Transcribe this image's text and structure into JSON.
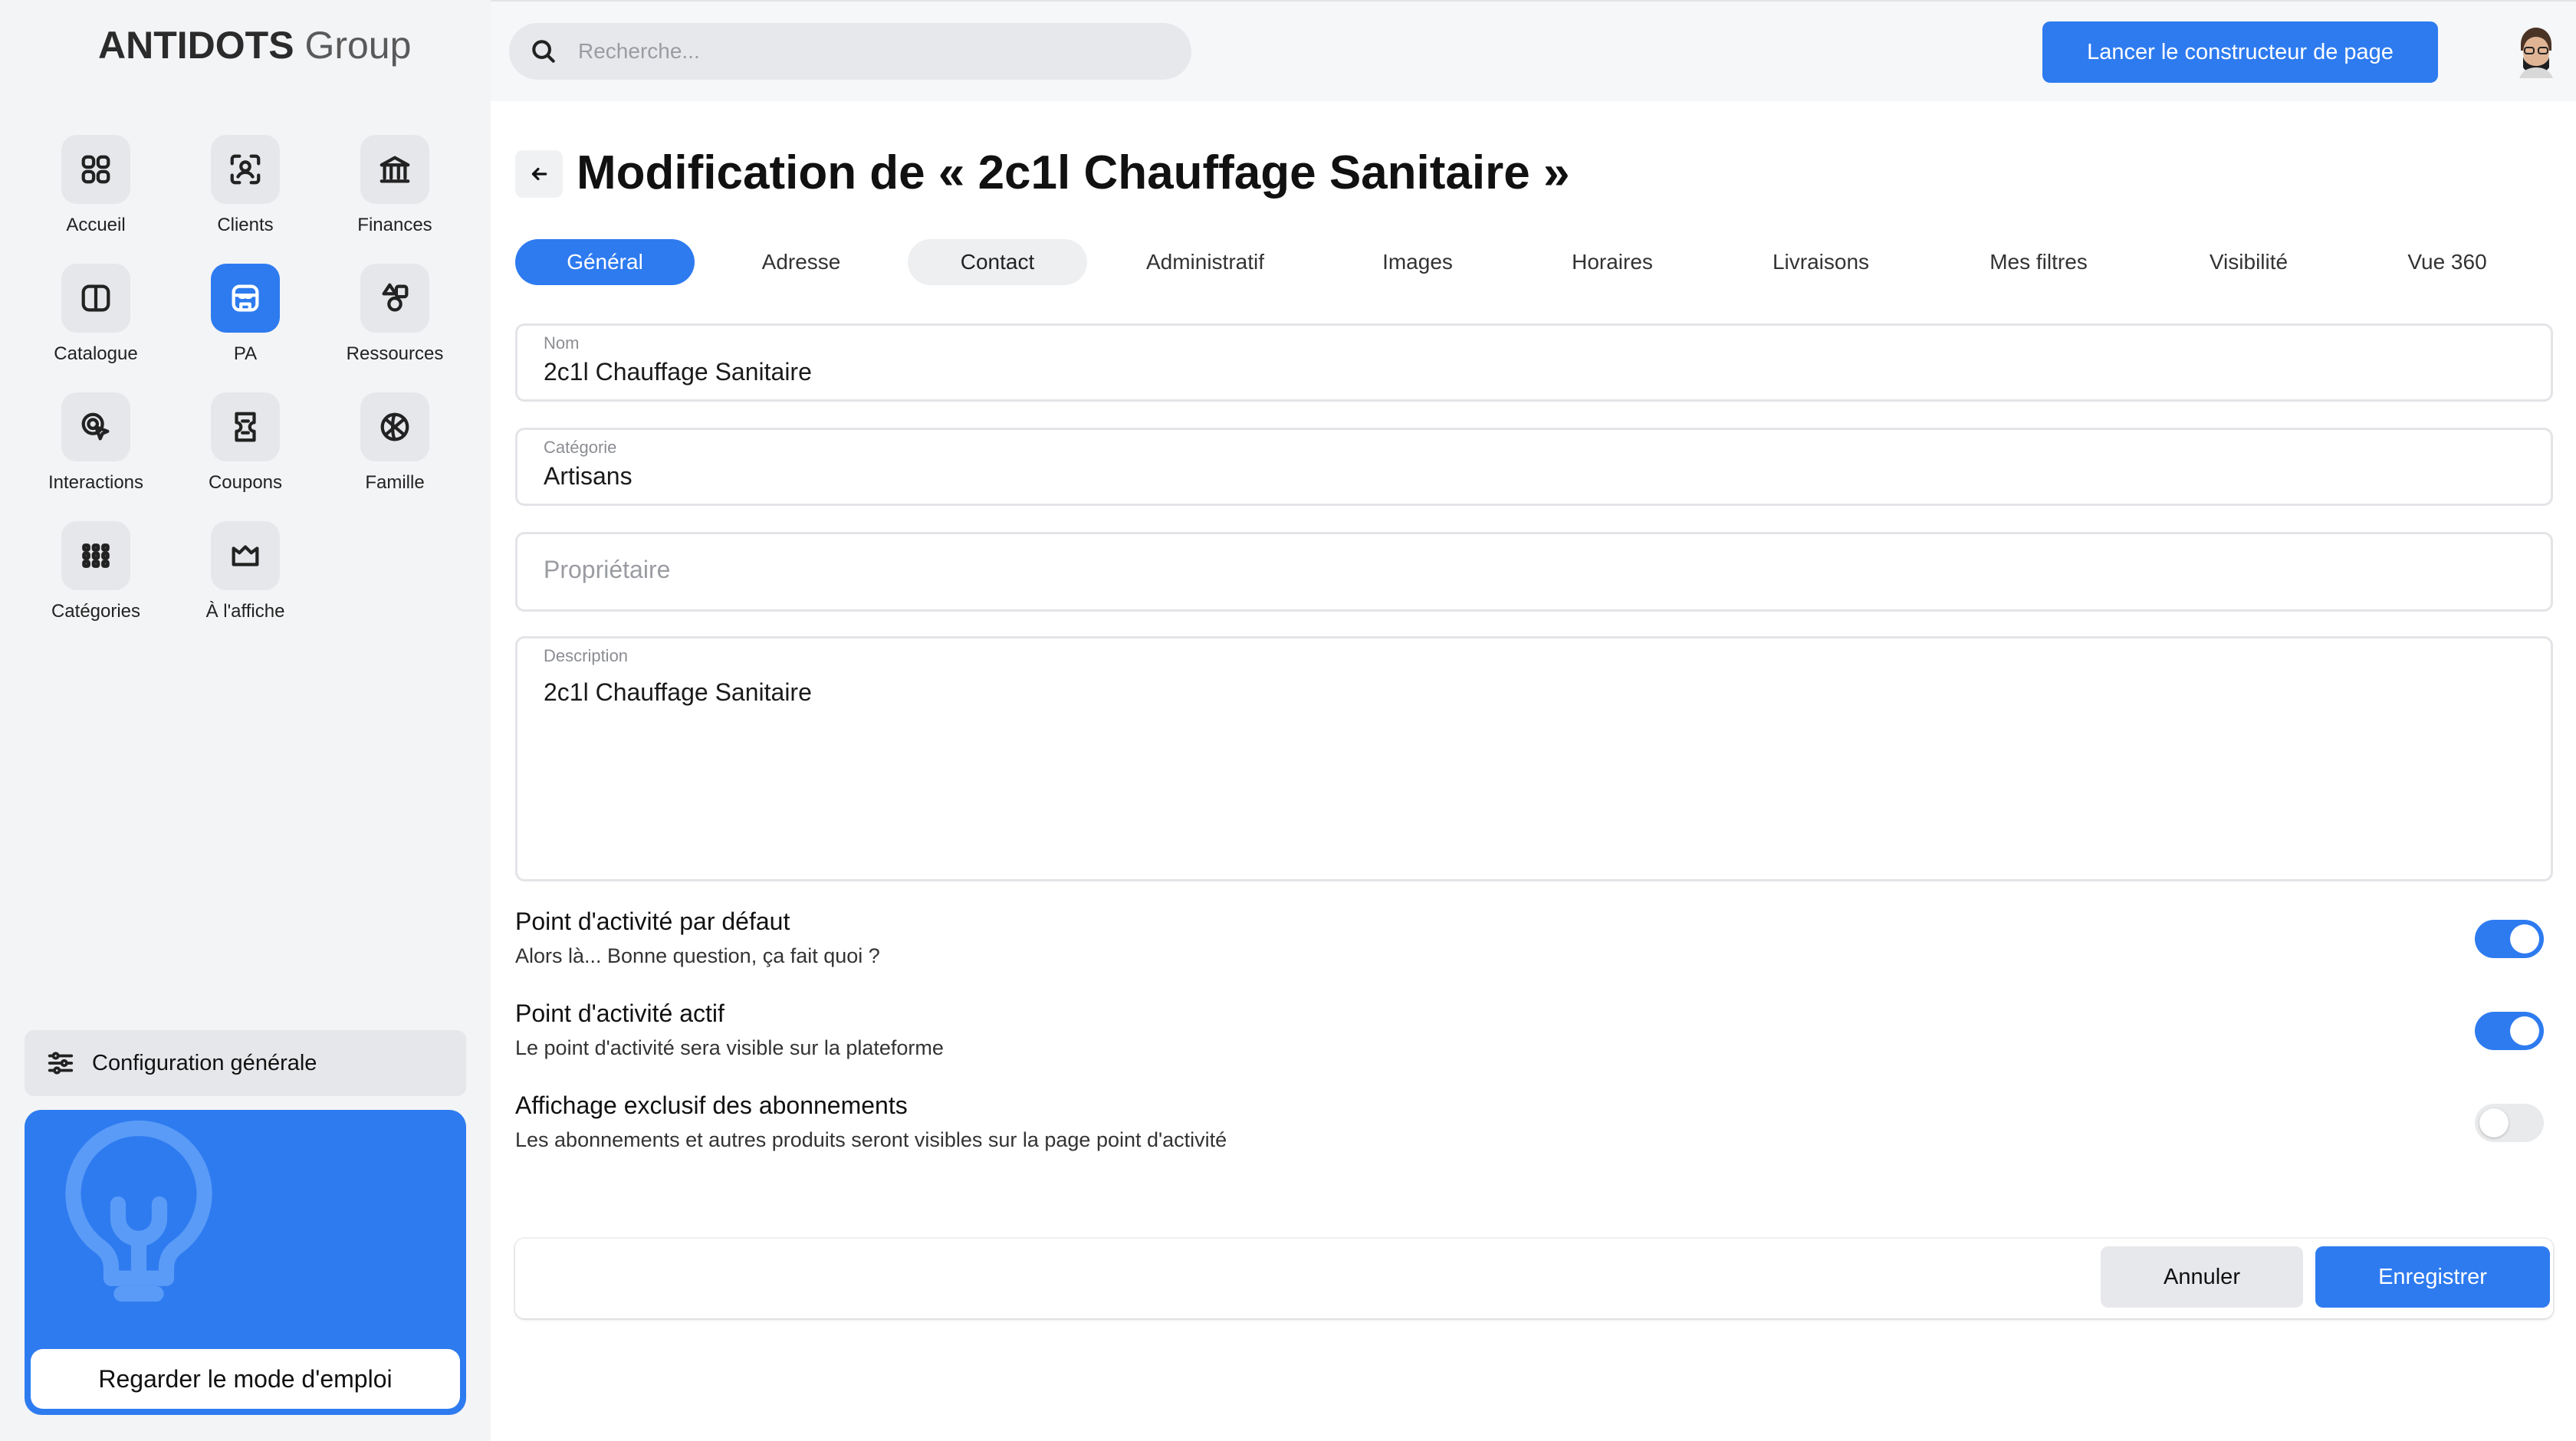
{
  "brand": {
    "name_bold": "ANTIDOTS",
    "name_light": " Group"
  },
  "sidebar": {
    "items": [
      {
        "label": "Accueil",
        "icon": "grid-icon"
      },
      {
        "label": "Clients",
        "icon": "user-scan-icon"
      },
      {
        "label": "Finances",
        "icon": "bank-icon"
      },
      {
        "label": "Catalogue",
        "icon": "book-icon"
      },
      {
        "label": "PA",
        "icon": "store-icon",
        "active": true
      },
      {
        "label": "Ressources",
        "icon": "shapes-icon"
      },
      {
        "label": "Interactions",
        "icon": "cursor-click-icon"
      },
      {
        "label": "Coupons",
        "icon": "ticket-icon"
      },
      {
        "label": "Famille",
        "icon": "basketball-icon"
      },
      {
        "label": "Catégories",
        "icon": "dots-grid-icon"
      },
      {
        "label": "À l'affiche",
        "icon": "crown-icon"
      }
    ],
    "config_label": "Configuration générale",
    "help_label": "Regarder le mode d'emploi"
  },
  "topbar": {
    "search_placeholder": "Recherche...",
    "builder_label": "Lancer le constructeur de page"
  },
  "page": {
    "title": "Modification de « 2c1l Chauffage Sanitaire »",
    "tabs": [
      {
        "label": "Général",
        "state": "active"
      },
      {
        "label": "Adresse",
        "state": ""
      },
      {
        "label": "Contact",
        "state": "hover"
      },
      {
        "label": "Administratif",
        "state": ""
      },
      {
        "label": "Images",
        "state": ""
      },
      {
        "label": "Horaires",
        "state": ""
      },
      {
        "label": "Livraisons",
        "state": ""
      },
      {
        "label": "Mes filtres",
        "state": ""
      },
      {
        "label": "Visibilité",
        "state": ""
      },
      {
        "label": "Vue 360",
        "state": ""
      }
    ],
    "fields": {
      "nom": {
        "label": "Nom",
        "value": "2c1l Chauffage Sanitaire"
      },
      "categorie": {
        "label": "Catégorie",
        "value": "Artisans"
      },
      "proprietaire": {
        "placeholder": "Propriétaire"
      },
      "description": {
        "label": "Description",
        "value": "2c1l Chauffage Sanitaire"
      }
    },
    "toggles": [
      {
        "title": "Point d'activité par défaut",
        "subtitle": "Alors là... Bonne question, ça fait quoi ?",
        "on": true
      },
      {
        "title": "Point d'activité actif",
        "subtitle": "Le point d'activité sera visible sur la plateforme",
        "on": true
      },
      {
        "title": "Affichage exclusif des abonnements",
        "subtitle": "Les abonnements et autres produits seront visibles sur la page point d'activité",
        "on": false
      }
    ],
    "cancel_label": "Annuler",
    "save_label": "Enregistrer"
  },
  "colors": {
    "accent": "#2e7bf0",
    "sidebar_bg": "#f3f4f6"
  }
}
